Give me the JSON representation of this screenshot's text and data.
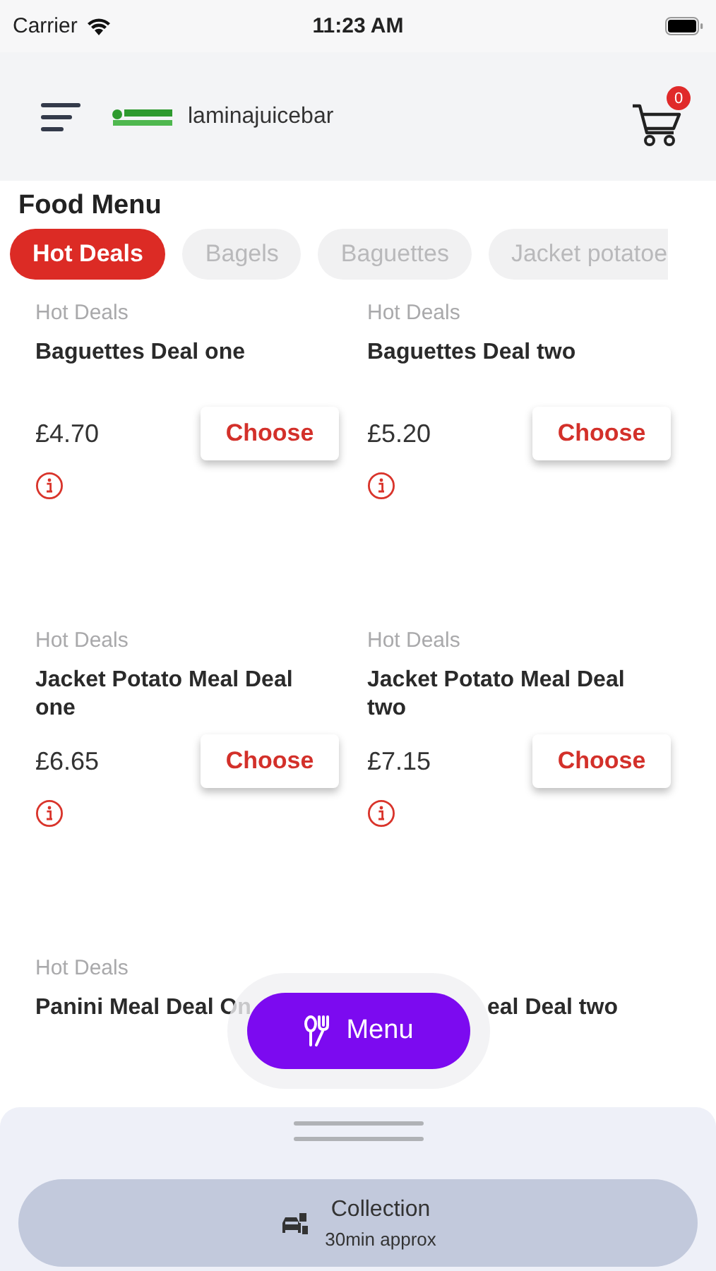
{
  "status_bar": {
    "carrier": "Carrier",
    "time": "11:23 AM"
  },
  "header": {
    "brand": "laminajuicebar",
    "cart_count": "0"
  },
  "section_title": "Food Menu",
  "tabs": [
    {
      "label": "Hot Deals",
      "selected": true
    },
    {
      "label": "Bagels",
      "selected": false
    },
    {
      "label": "Baguettes",
      "selected": false
    },
    {
      "label": "Jacket potatoe",
      "selected": false
    }
  ],
  "items": [
    {
      "category": "Hot Deals",
      "name": "Baguettes Deal one",
      "price": "£4.70",
      "button": "Choose"
    },
    {
      "category": "Hot Deals",
      "name": "Baguettes Deal two",
      "price": "£5.20",
      "button": "Choose"
    },
    {
      "category": "Hot Deals",
      "name": "Jacket Potato Meal Deal one",
      "price": "£6.65",
      "button": "Choose"
    },
    {
      "category": "Hot Deals",
      "name": "Jacket Potato Meal Deal two",
      "price": "£7.15",
      "button": "Choose"
    },
    {
      "category": "Hot Deals",
      "name": "Panini Meal Deal On"
    },
    {
      "name": "eal Deal two"
    }
  ],
  "menu_button": "Menu",
  "bottom_sheet": {
    "mode": "Collection",
    "eta": "30min approx"
  }
}
